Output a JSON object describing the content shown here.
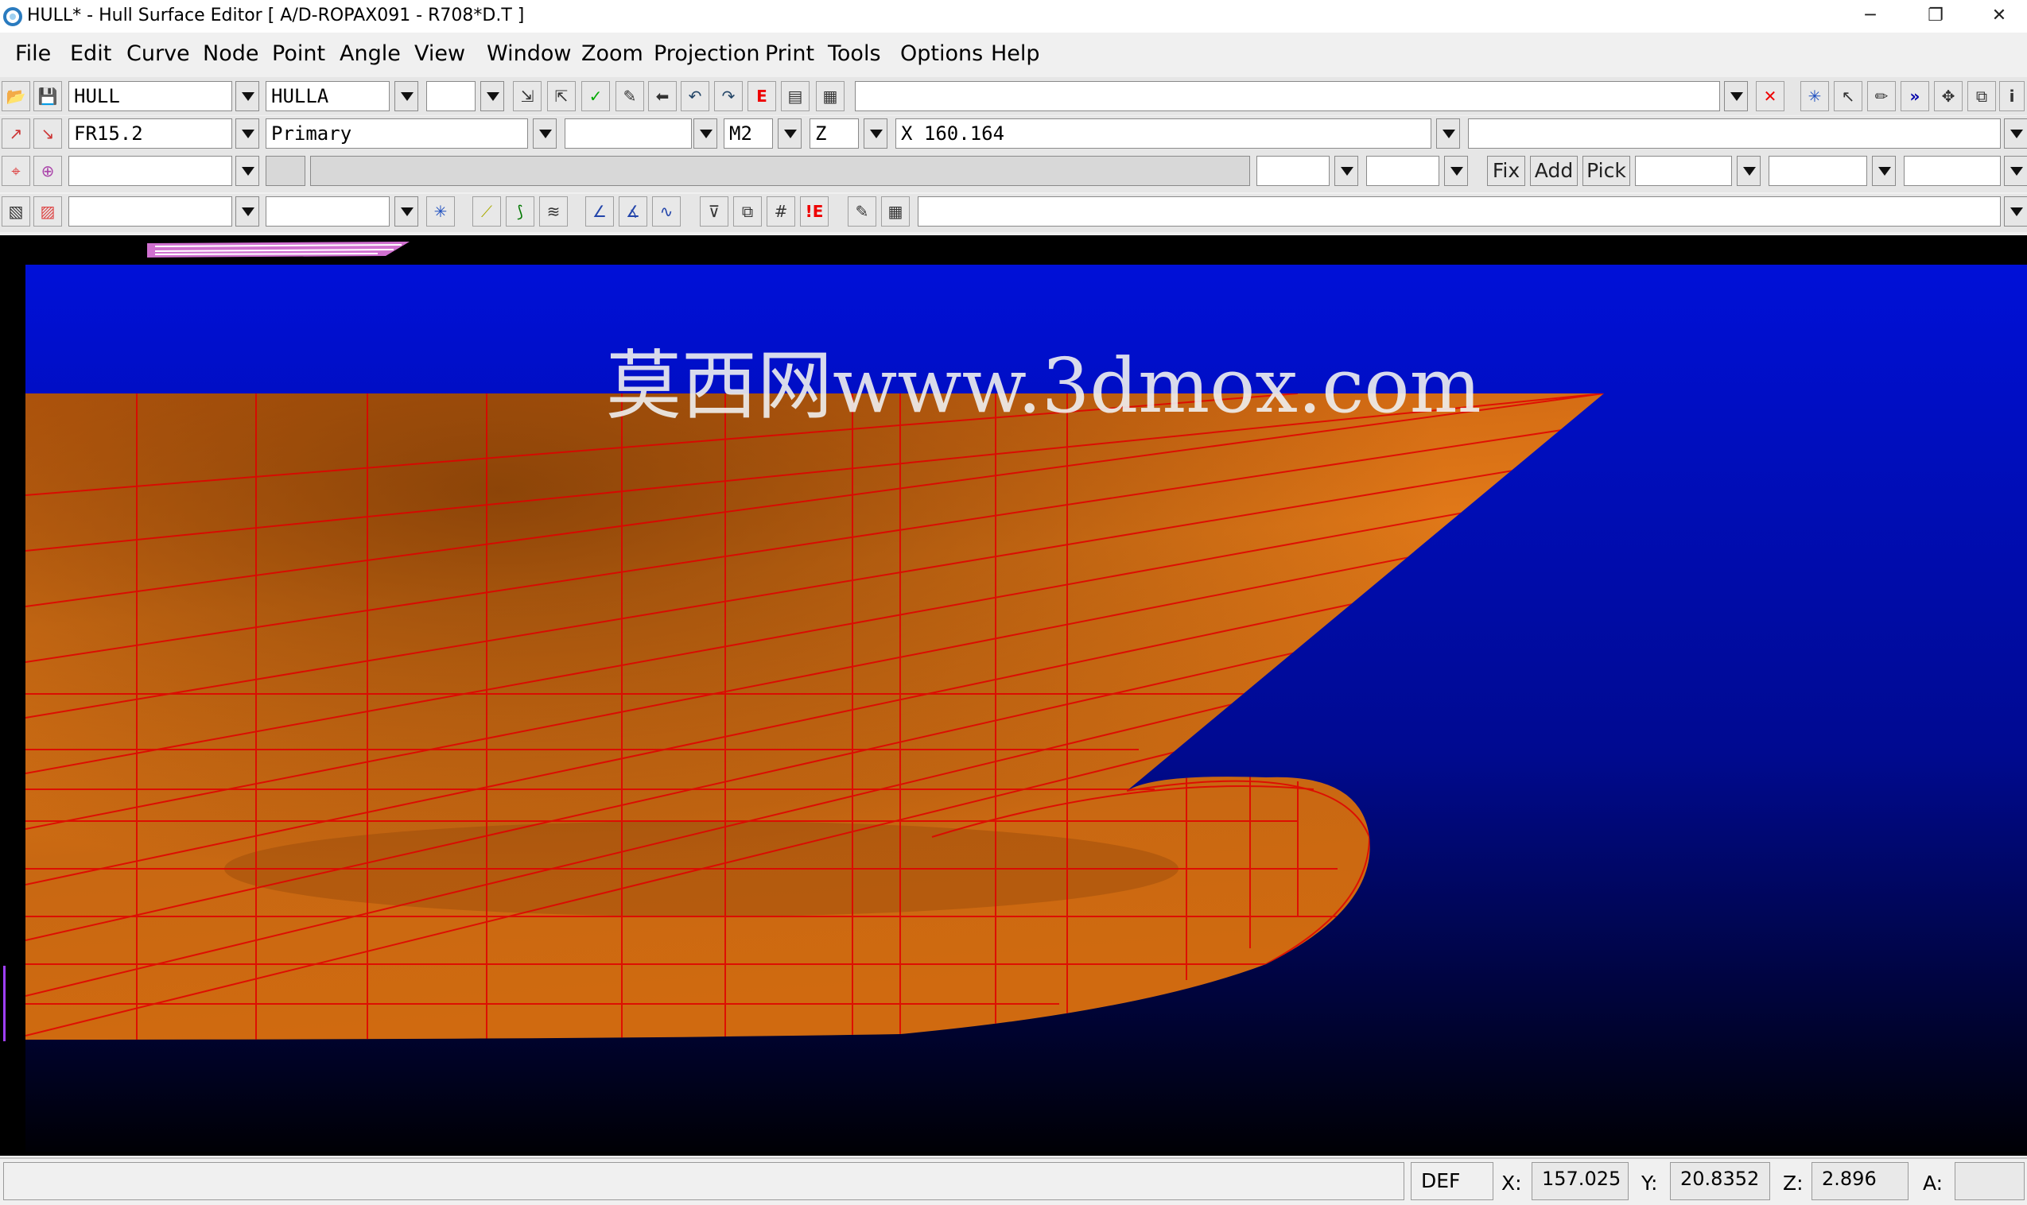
{
  "window": {
    "title": "HULL* - Hull Surface Editor [ A/D-ROPAX091 - R708*D.T ]",
    "minimize": "─",
    "restore": "❐",
    "close": "✕"
  },
  "menu": [
    "File",
    "Edit",
    "Curve",
    "Node",
    "Point",
    "Angle",
    "View",
    "Window",
    "Zoom",
    "Projection",
    "Print",
    "Tools",
    "Options",
    "Help"
  ],
  "toolbar1": {
    "surface": "HULL",
    "object": "HULLA",
    "field3": "",
    "command": ""
  },
  "toolbar2": {
    "curve": "FR15.2",
    "kind": "Primary",
    "field3": "",
    "unit": "M2",
    "axis": "Z",
    "position": "X 160.164",
    "extra": ""
  },
  "toolbar3": {
    "fix": "Fix",
    "add": "Add",
    "pick": "Pick"
  },
  "viewport": {
    "watermark": "莫西网www.3dmox.com",
    "colors": {
      "sky_top": "#0010d8",
      "sky_bottom": "#000005",
      "hull": "#d06a10",
      "grid": "#e00000"
    }
  },
  "status": {
    "mode": "DEF",
    "x_label": "X:",
    "x": "157.025",
    "y_label": "Y:",
    "y": "20.8352",
    "z_label": "Z:",
    "z": "2.896",
    "a_label": "A:",
    "a": ""
  }
}
